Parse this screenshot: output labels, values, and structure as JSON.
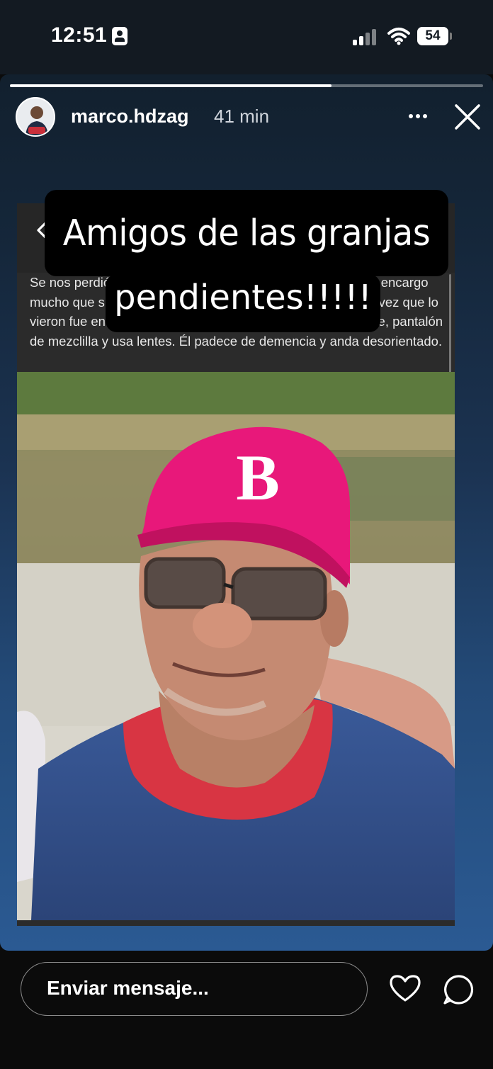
{
  "status_bar": {
    "time": "12:51",
    "battery": "54",
    "person_icon": "person-id-icon",
    "signal_icon": "signal-bars-icon",
    "wifi_icon": "wifi-icon",
    "battery_icon": "battery-icon"
  },
  "story": {
    "progress_fraction": 0.68,
    "username": "marco.hdzag",
    "time_ago": "41 min",
    "caption_line1": "Amigos de las granjas",
    "caption_line2": "pendientes!!!!!",
    "icons": {
      "more": "more-horizontal-icon",
      "close": "close-icon"
    }
  },
  "embedded_post": {
    "back_icon": "chevron-left-icon",
    "more_icon": "more-horizontal-icon",
    "text": "Se nos perdió mi padre y no hemos podido encontrarlo. Les encargo mucho que si lo ven me lo detengan y me llamen. La última vez que lo vieron fue en zaragoza y tecnológico, tres camisa color beige, pantalón de mezclilla y usa lentes. Él padece de demencia y anda desorientado.",
    "cap_letter": "B"
  },
  "bottom_bar": {
    "message_placeholder": "Enviar mensaje...",
    "like_icon": "heart-icon",
    "send_icon": "send-message-icon"
  },
  "colors": {
    "cap_pink": "#e8187a",
    "shirt_blue": "#2f4c86",
    "collar_red": "#d83543"
  }
}
